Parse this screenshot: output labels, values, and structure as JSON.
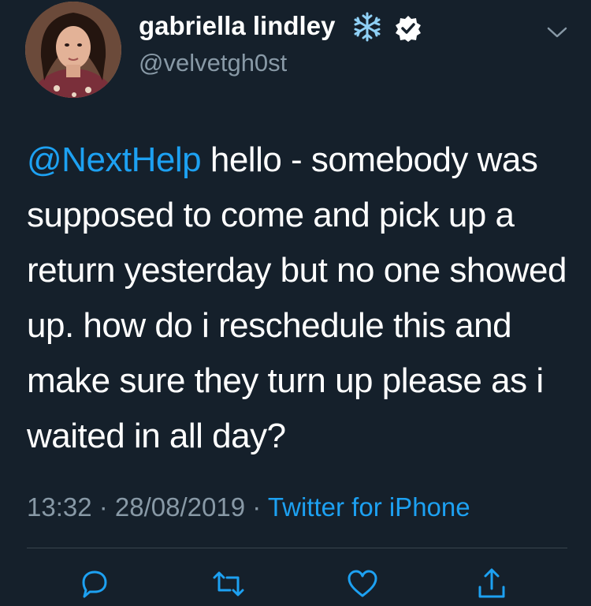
{
  "user": {
    "display_name": "gabriella lindley",
    "handle": "@velvetgh0st",
    "badges": [
      "snowflake-icon",
      "verified-badge-icon"
    ]
  },
  "tweet": {
    "mention": "@NextHelp",
    "text": " hello - somebody was supposed to come and pick up a return yesterday but no one showed up. how do i reschedule this and make sure they turn up please as i waited in all day?"
  },
  "meta": {
    "time": "13:32",
    "separator": " · ",
    "date": "28/08/2019",
    "source": "Twitter for iPhone"
  },
  "actions": [
    "reply-icon",
    "retweet-icon",
    "like-icon",
    "share-icon"
  ],
  "colors": {
    "background": "#15202b",
    "accent": "#1da1f2",
    "secondary_text": "#8899a6",
    "divider": "#38444d"
  }
}
